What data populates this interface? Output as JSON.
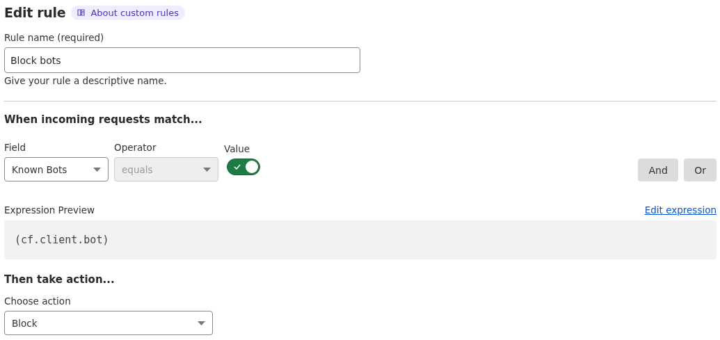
{
  "title": "Edit rule",
  "help_link": {
    "label": "About custom rules"
  },
  "rule_name": {
    "label": "Rule name (required)",
    "value": "Block bots",
    "hint": "Give your rule a descriptive name."
  },
  "match_heading": "When incoming requests match...",
  "condition": {
    "field": {
      "label": "Field",
      "value": "Known Bots",
      "disabled": false
    },
    "operator": {
      "label": "Operator",
      "value": "equals",
      "disabled": true
    },
    "value": {
      "label": "Value",
      "on": true
    }
  },
  "logic_buttons": [
    "And",
    "Or"
  ],
  "expression": {
    "label": "Expression Preview",
    "edit_link": "Edit expression",
    "code": "(cf.client.bot)"
  },
  "action_heading": "Then take action...",
  "action": {
    "label": "Choose action",
    "value": "Block"
  }
}
